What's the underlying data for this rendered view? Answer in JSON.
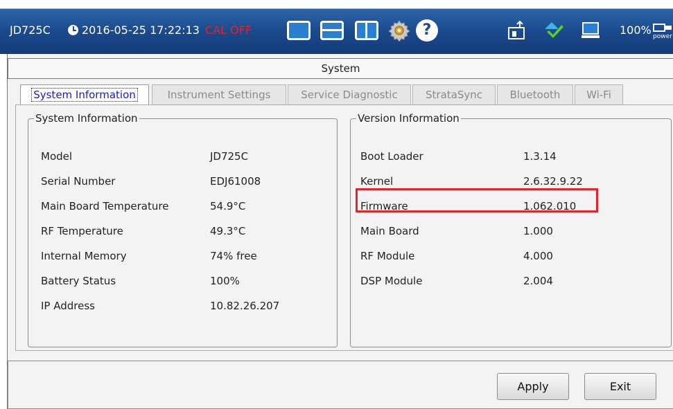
{
  "status_bar": {
    "model": "JD725C",
    "datetime": "2016-05-25 17:22:13",
    "cal_status": "CAL OFF",
    "battery": "100%",
    "power_label": "power",
    "colors": {
      "background": "#1b4a8e",
      "cal_status": "#e8202a"
    },
    "icons": [
      "clock-icon",
      "layout-full-icon",
      "layout-split-h-icon",
      "layout-split-v-icon",
      "gear-icon",
      "help-icon",
      "usb-icon",
      "sync-icon",
      "screen-icon",
      "power-icon"
    ]
  },
  "window": {
    "title": "System"
  },
  "tabs": [
    {
      "label": "System Information",
      "active": true
    },
    {
      "label": "Instrument Settings",
      "active": false
    },
    {
      "label": "Service Diagnostic",
      "active": false
    },
    {
      "label": "StrataSync",
      "active": false
    },
    {
      "label": "Bluetooth",
      "active": false
    },
    {
      "label": "Wi-Fi",
      "active": false
    }
  ],
  "system_info": {
    "title": "System Information",
    "rows": [
      {
        "label": "Model",
        "value": "JD725C"
      },
      {
        "label": "Serial Number",
        "value": "EDJ61008"
      },
      {
        "label": "Main Board Temperature",
        "value": "54.9°C"
      },
      {
        "label": "RF Temperature",
        "value": "49.3°C"
      },
      {
        "label": "Internal Memory",
        "value": "74% free"
      },
      {
        "label": "Battery Status",
        "value": "100%"
      },
      {
        "label": "IP Address",
        "value": "10.82.26.207"
      }
    ]
  },
  "version_info": {
    "title": "Version Information",
    "rows": [
      {
        "label": "Boot Loader",
        "value": "1.3.14"
      },
      {
        "label": "Kernel",
        "value": "2.6.32.9.22"
      },
      {
        "label": "Firmware",
        "value": "1.062.010",
        "highlighted": true
      },
      {
        "label": "Main Board",
        "value": "1.000"
      },
      {
        "label": "RF Module",
        "value": "4.000"
      },
      {
        "label": "DSP Module",
        "value": "2.004"
      }
    ],
    "highlight_color": "#e2242c"
  },
  "buttons": {
    "apply": "Apply",
    "exit": "Exit"
  }
}
